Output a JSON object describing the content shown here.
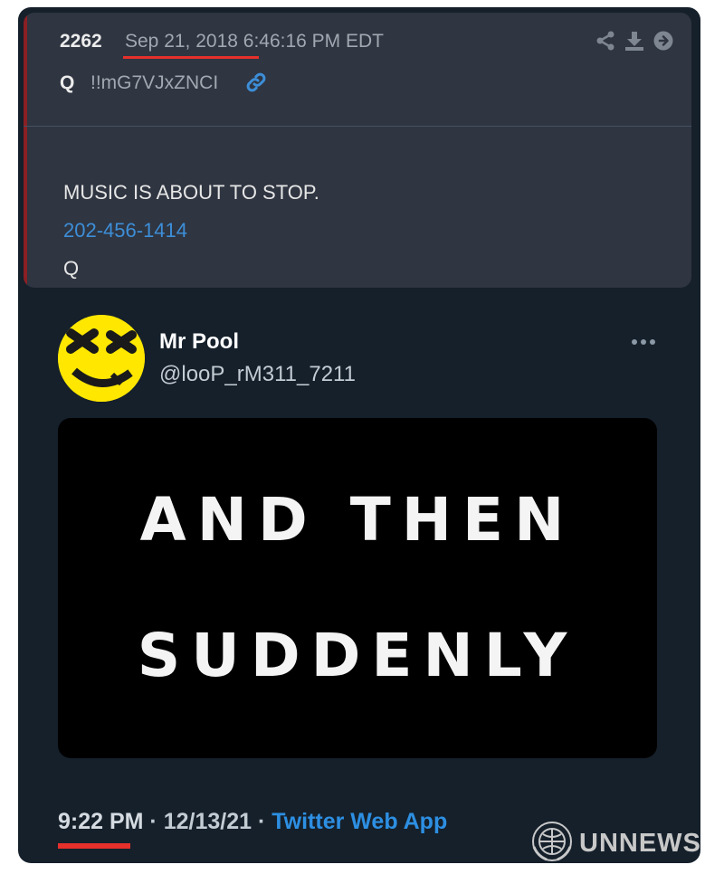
{
  "qpost": {
    "post_number": "2262",
    "date": "Sep 21, 2018 6:46:16 PM EDT",
    "name": "Q",
    "tripcode": "!!mG7VJxZNCI",
    "body": {
      "line1": "MUSIC IS ABOUT TO STOP.",
      "phone": "202-456-1414",
      "sign": "Q"
    },
    "icons": [
      "share-icon",
      "download-icon",
      "arrow-right-icon",
      "link-icon"
    ]
  },
  "tweet": {
    "name": "Mr Pool",
    "handle": "@looP_rM311_7211",
    "media": {
      "line1": "AND THEN",
      "line2": "SUDDENLY"
    },
    "time": "9:22 PM",
    "separator1": " · ",
    "date": "12/13/21",
    "separator2": " · ",
    "source": "Twitter Web App"
  },
  "watermark": {
    "text": "UNNEWS"
  },
  "colors": {
    "background": "#15202b",
    "qpost_bg": "#2f3541",
    "accent_red": "#e5302b",
    "link_blue": "#3d8ed8",
    "twitter_blue": "#2d8fe2",
    "avatar_yellow": "#ffe700"
  }
}
